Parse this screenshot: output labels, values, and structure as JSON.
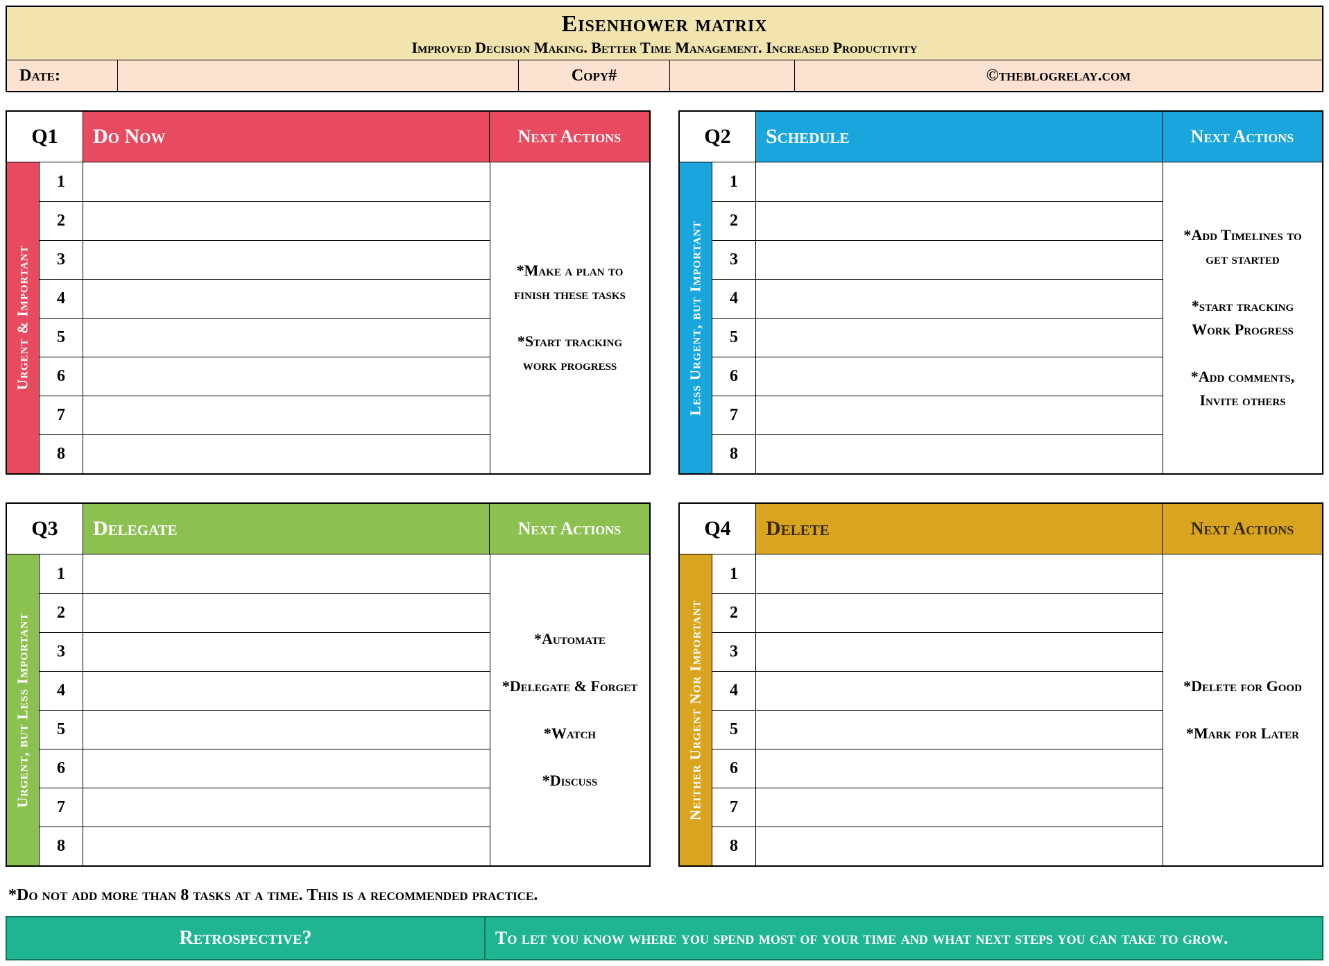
{
  "header": {
    "title": "Eisenhower matrix",
    "subtitle": "Improved Decision Making. Better Time Management. Increased Productivity",
    "date_label": "Date:",
    "date_value": "",
    "copy_label": "Copy#",
    "copy_value": "",
    "copyright": "©theblogrelay.com"
  },
  "rows": [
    "1",
    "2",
    "3",
    "4",
    "5",
    "6",
    "7",
    "8"
  ],
  "next_label": "Next Actions",
  "q1": {
    "code": "Q1",
    "title": "Do Now",
    "side": "Urgent & Important",
    "actions": "*Make a plan to finish these tasks\n\n*Start tracking work progress",
    "color": "#e84a5f"
  },
  "q2": {
    "code": "Q2",
    "title": "Schedule",
    "side": "Less Urgent, but Important",
    "actions": "*Add Timelines to get started\n\n*start tracking Work Progress\n\n*Add comments, Invite others",
    "color": "#1aa6dc"
  },
  "q3": {
    "code": "Q3",
    "title": "Delegate",
    "side": "Urgent, but Less Important",
    "actions": "*Automate\n\n*Delegate & Forget\n\n*Watch\n\n*Discuss",
    "color": "#8cc152"
  },
  "q4": {
    "code": "Q4",
    "title": "Delete",
    "side": "Neither Urgent Nor Important",
    "actions": "*Delete for Good\n\n*Mark for Later",
    "color": "#d9a520"
  },
  "footnote": "*Do not add more than 8 tasks at a time. This is a recommended practice.",
  "retro": {
    "label": "Retrospective?",
    "text": "To let you know where you spend most of your time and what next steps you can take to grow."
  }
}
